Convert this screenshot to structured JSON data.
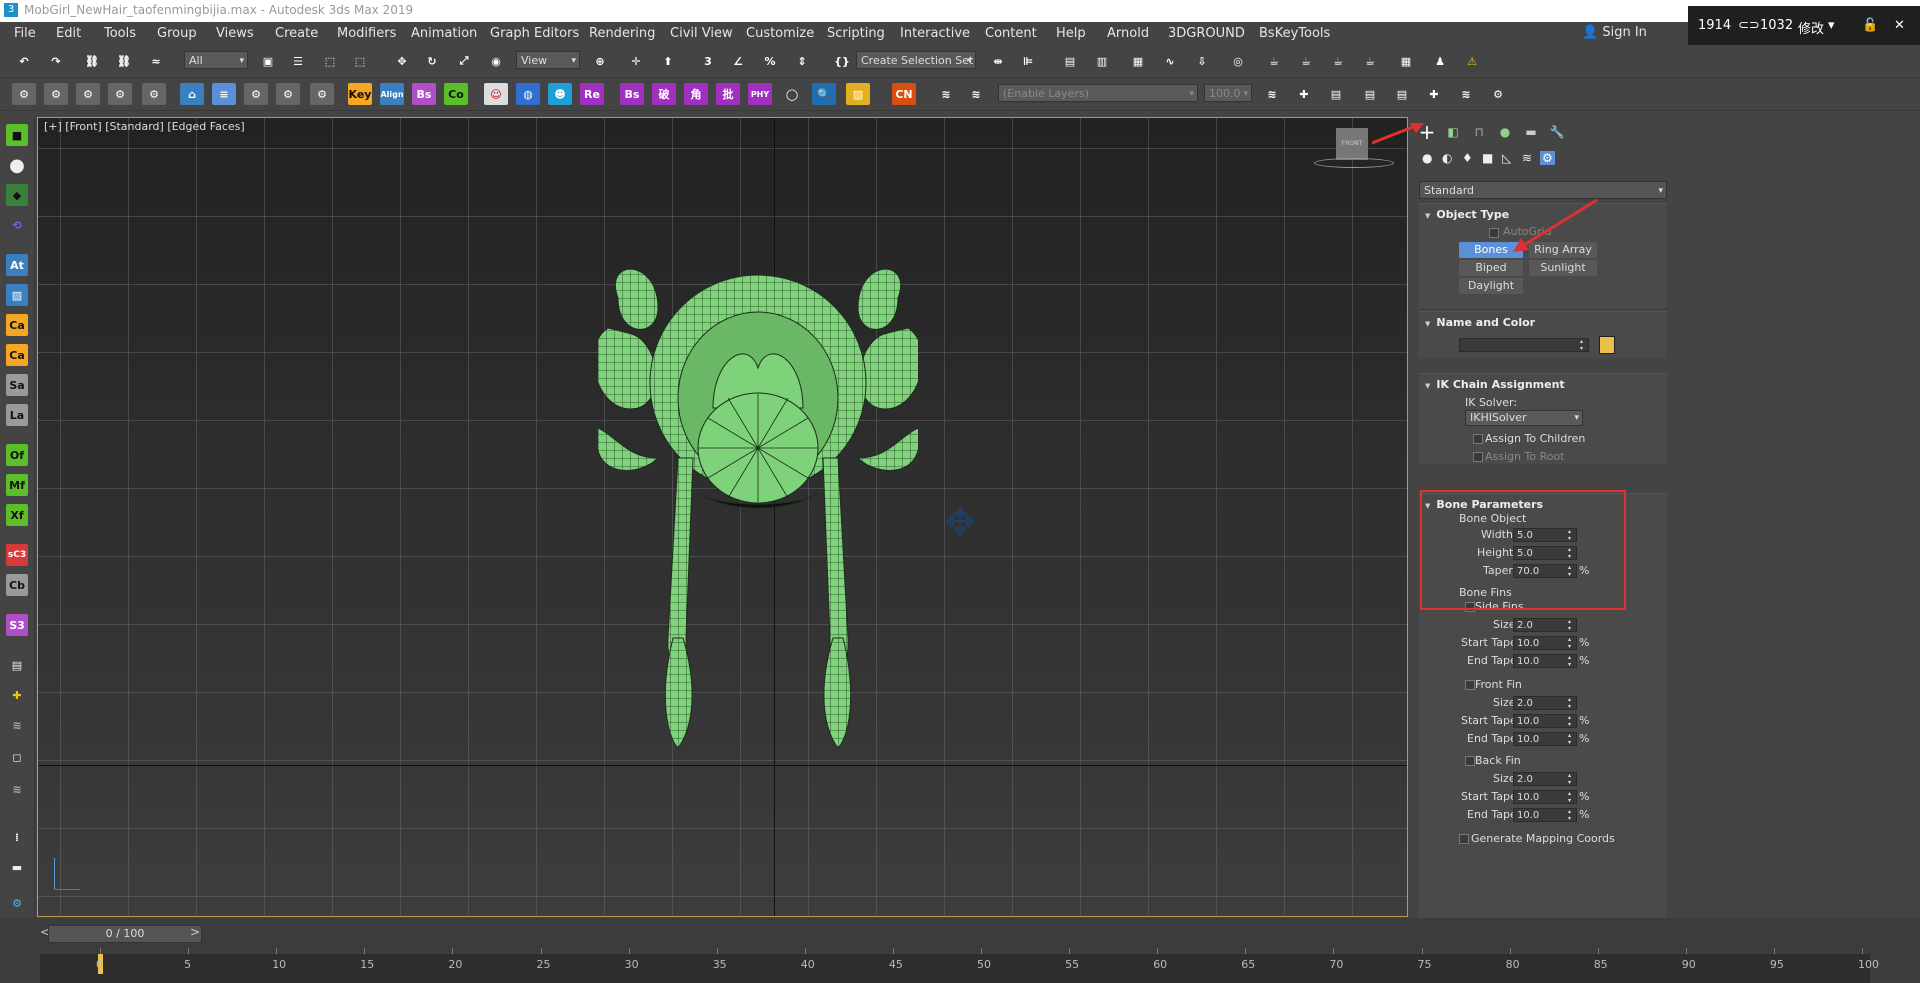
{
  "window": {
    "title": "MobGirl_NewHair_taofenmingbijia.max - Autodesk 3ds Max 2019",
    "app_icon": "3"
  },
  "menu": [
    "File",
    "Edit",
    "Tools",
    "Group",
    "Views",
    "Create",
    "Modifiers",
    "Animation",
    "Graph Editors",
    "Rendering",
    "Civil View",
    "Customize",
    "Scripting",
    "Interactive",
    "Content",
    "Help",
    "Arnold",
    "3DGROUND",
    "BsKeyTools"
  ],
  "signin": "Sign In",
  "overlay": {
    "w": "1914",
    "h": "1032",
    "action": "修改"
  },
  "toolbar1": {
    "filter": "All",
    "ref_coord": "View",
    "selection_set": "Create Selection Set"
  },
  "toolbar2": {
    "buttons": [
      "Key",
      "Align",
      "Bs",
      "Co",
      "Re",
      "Bs",
      "破",
      "角",
      "批",
      "PHY",
      "CN"
    ],
    "layer_select": "(Enable Layers)",
    "layer_value": "100.0"
  },
  "leftbar": [
    "At",
    "Ca",
    "Ca",
    "Sa",
    "La",
    "Of",
    "Mf",
    "Xf",
    "sC3",
    "Cb",
    "S3"
  ],
  "viewport": {
    "label": "[+] [Front] [Standard] [Edged Faces]",
    "viewcube": "FRONT"
  },
  "cmdpanel": {
    "category": "Standard",
    "object_type": {
      "title": "Object Type",
      "autogrid": "AutoGrid",
      "buttons": [
        "Bones",
        "Ring Array",
        "Biped",
        "Sunlight",
        "Daylight"
      ]
    },
    "name_color": {
      "title": "Name and Color",
      "name": "",
      "color": "#e8c04a"
    },
    "ik": {
      "title": "IK Chain Assignment",
      "solver_label": "IK Solver:",
      "solver": "IKHISolver",
      "assign_children": "Assign To Children",
      "assign_root": "Assign To Root"
    },
    "bone_params": {
      "title": "Bone Parameters",
      "group": "Bone Object",
      "width_label": "Width:",
      "width": "5.0",
      "height_label": "Height:",
      "height": "5.0",
      "taper_label": "Taper:",
      "taper": "70.0"
    },
    "fins": {
      "group": "Bone Fins",
      "side": {
        "label": "Side Fins",
        "size": "2.0",
        "start": "10.0",
        "end": "10.0"
      },
      "front": {
        "label": "Front Fin",
        "size": "2.0",
        "start": "10.0",
        "end": "10.0"
      },
      "back": {
        "label": "Back Fin",
        "size": "2.0",
        "start": "10.0",
        "end": "10.0"
      },
      "size_label": "Size:",
      "start_label": "Start Taper:",
      "end_label": "End Taper:",
      "pct": "%"
    },
    "gen_mapping": "Generate Mapping Coords"
  },
  "timeline": {
    "frame": "0 / 100",
    "ticks": [
      "0",
      "5",
      "10",
      "15",
      "20",
      "25",
      "30",
      "35",
      "40",
      "45",
      "50",
      "55",
      "60",
      "65",
      "70",
      "75",
      "80",
      "85",
      "90",
      "95",
      "100"
    ]
  },
  "colors": {
    "accent": "#5b8fd8",
    "highlight": "#e03030",
    "mesh": "#7ed27a",
    "viewport_border": "#b89b4e"
  }
}
